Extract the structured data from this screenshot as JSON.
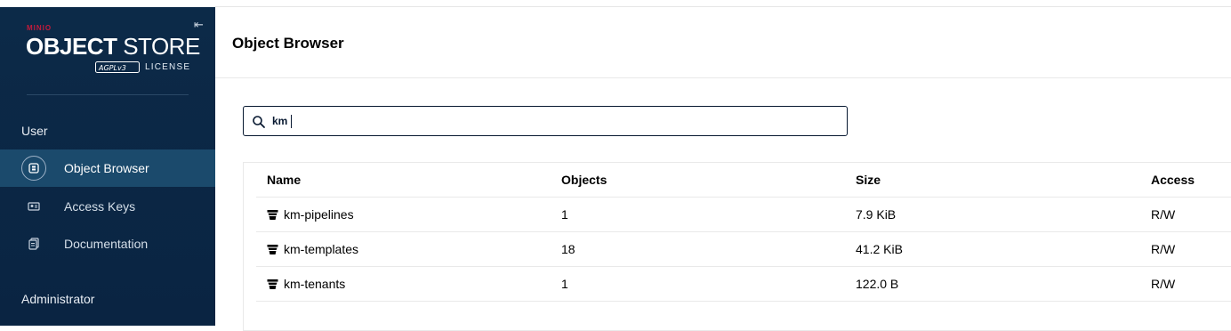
{
  "sidebar": {
    "brand": {
      "minio": "MINIO",
      "object": "OBJECT",
      "store": "STORE",
      "license": "LICENSE",
      "agpl": "AGPLv3"
    },
    "collapse_icon": "collapse-left-icon",
    "sections": {
      "user": "User",
      "administrator": "Administrator"
    },
    "items": [
      {
        "label": "Object Browser",
        "icon": "object-browser-icon",
        "active": true
      },
      {
        "label": "Access Keys",
        "icon": "access-keys-icon",
        "active": false
      },
      {
        "label": "Documentation",
        "icon": "documentation-icon",
        "active": false
      }
    ]
  },
  "header": {
    "title": "Object Browser"
  },
  "search": {
    "value": "km",
    "placeholder": ""
  },
  "table": {
    "columns": [
      "Name",
      "Objects",
      "Size",
      "Access"
    ],
    "rows": [
      {
        "name": "km-pipelines",
        "objects": "1",
        "size": "7.9 KiB",
        "access": "R/W"
      },
      {
        "name": "km-templates",
        "objects": "18",
        "size": "41.2 KiB",
        "access": "R/W"
      },
      {
        "name": "km-tenants",
        "objects": "1",
        "size": "122.0 B",
        "access": "R/W"
      }
    ]
  },
  "colors": {
    "sidebar_bg": "#0c2a48",
    "sidebar_active": "#1b4a6c",
    "brand_red": "#c51b3b",
    "ink": "#071830"
  }
}
